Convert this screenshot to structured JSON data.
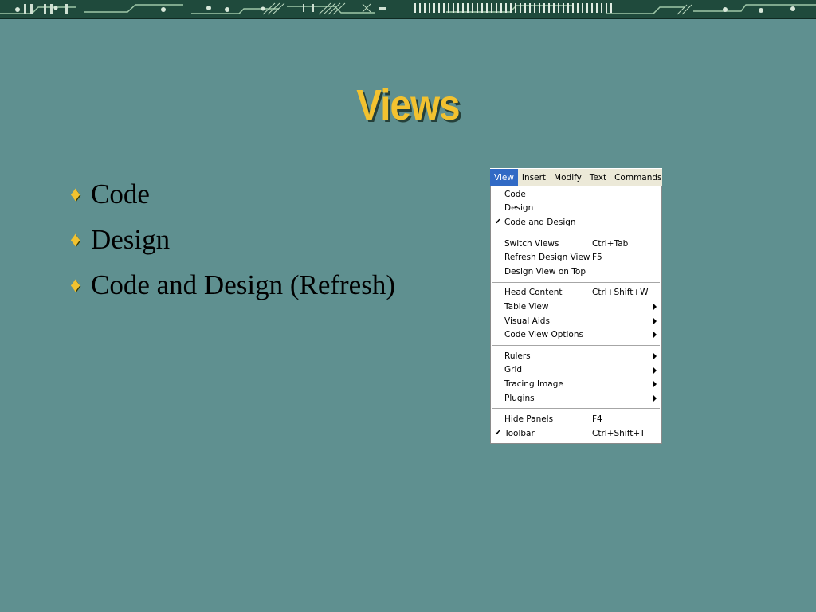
{
  "slide": {
    "title": "Views",
    "bullets": [
      {
        "text": "Code"
      },
      {
        "text": "Design"
      },
      {
        "text": "Code and Design (Refresh)"
      }
    ],
    "bullet_marker": "♦"
  },
  "menu": {
    "menubar": [
      "View",
      "Insert",
      "Modify",
      "Text",
      "Commands"
    ],
    "active_menubar": "View",
    "groups": [
      [
        {
          "label": "Code",
          "shortcut": "",
          "checked": false,
          "submenu": false
        },
        {
          "label": "Design",
          "shortcut": "",
          "checked": false,
          "submenu": false
        },
        {
          "label": "Code and Design",
          "shortcut": "",
          "checked": true,
          "submenu": false
        }
      ],
      [
        {
          "label": "Switch Views",
          "shortcut": "Ctrl+Tab",
          "checked": false,
          "submenu": false
        },
        {
          "label": "Refresh Design View",
          "shortcut": "F5",
          "checked": false,
          "submenu": false
        },
        {
          "label": "Design View on Top",
          "shortcut": "",
          "checked": false,
          "submenu": false
        }
      ],
      [
        {
          "label": "Head Content",
          "shortcut": "Ctrl+Shift+W",
          "checked": false,
          "submenu": false
        },
        {
          "label": "Table View",
          "shortcut": "",
          "checked": false,
          "submenu": true
        },
        {
          "label": "Visual Aids",
          "shortcut": "",
          "checked": false,
          "submenu": true
        },
        {
          "label": "Code View Options",
          "shortcut": "",
          "checked": false,
          "submenu": true
        }
      ],
      [
        {
          "label": "Rulers",
          "shortcut": "",
          "checked": false,
          "submenu": true
        },
        {
          "label": "Grid",
          "shortcut": "",
          "checked": false,
          "submenu": true
        },
        {
          "label": "Tracing Image",
          "shortcut": "",
          "checked": false,
          "submenu": true
        },
        {
          "label": "Plugins",
          "shortcut": "",
          "checked": false,
          "submenu": true
        }
      ],
      [
        {
          "label": "Hide Panels",
          "shortcut": "F4",
          "checked": false,
          "submenu": false
        },
        {
          "label": "Toolbar",
          "shortcut": "Ctrl+Shift+T",
          "checked": true,
          "submenu": false
        }
      ]
    ],
    "check_glyph": "✔"
  },
  "colors": {
    "background": "#5f9090",
    "title": "#f2c230",
    "banner": "#1f4a3c",
    "menu_highlight": "#316ac5"
  }
}
